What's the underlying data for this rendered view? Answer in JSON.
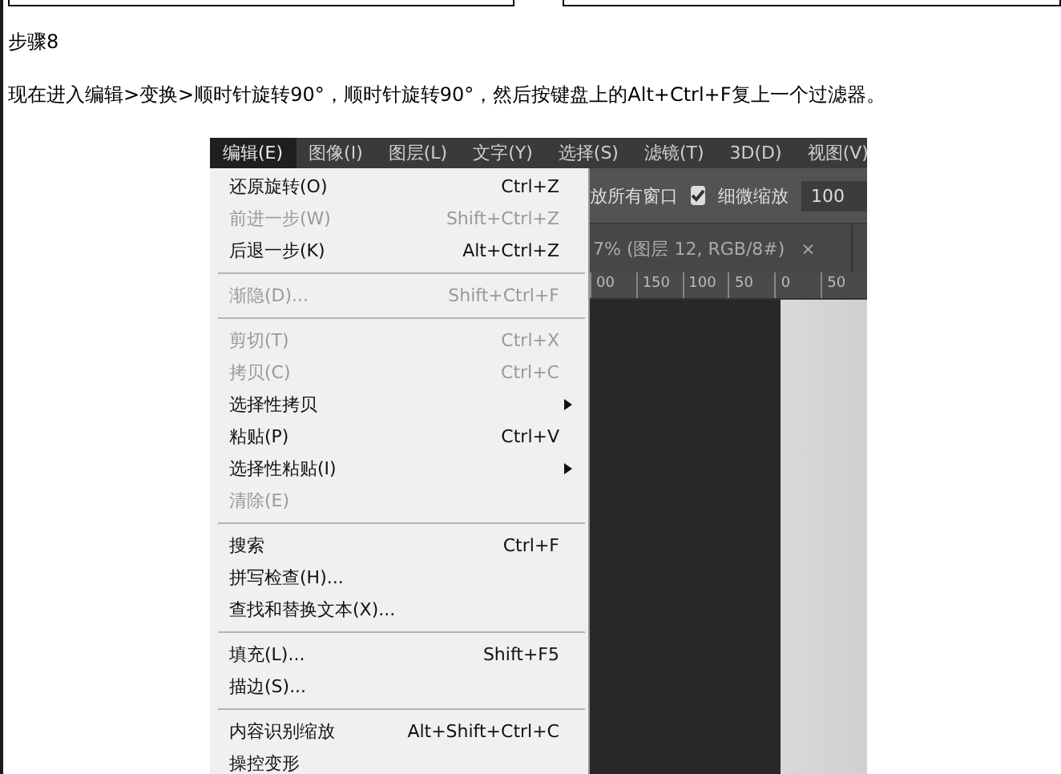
{
  "article": {
    "step_title": "步骤8",
    "paragraph": "现在进入编辑>变换>顺时针旋转90°，顺时针旋转90°，然后按键盘上的Alt+Ctrl+F复上一个过滤器。"
  },
  "screenshot": {
    "menubar": [
      {
        "label": "编辑(E)",
        "selected": true
      },
      {
        "label": "图像(I)",
        "selected": false
      },
      {
        "label": "图层(L)",
        "selected": false
      },
      {
        "label": "文字(Y)",
        "selected": false
      },
      {
        "label": "选择(S)",
        "selected": false
      },
      {
        "label": "滤镜(T)",
        "selected": false
      },
      {
        "label": "3D(D)",
        "selected": false
      },
      {
        "label": "视图(V)",
        "selected": false
      }
    ],
    "edit_menu": [
      {
        "kind": "item",
        "label": "还原旋转(O)",
        "shortcut": "Ctrl+Z",
        "disabled": false
      },
      {
        "kind": "item",
        "label": "前进一步(W)",
        "shortcut": "Shift+Ctrl+Z",
        "disabled": true
      },
      {
        "kind": "item",
        "label": "后退一步(K)",
        "shortcut": "Alt+Ctrl+Z",
        "disabled": false
      },
      {
        "kind": "separator"
      },
      {
        "kind": "item",
        "label": "渐隐(D)...",
        "shortcut": "Shift+Ctrl+F",
        "disabled": true
      },
      {
        "kind": "separator"
      },
      {
        "kind": "item",
        "label": "剪切(T)",
        "shortcut": "Ctrl+X",
        "disabled": true
      },
      {
        "kind": "item",
        "label": "拷贝(C)",
        "shortcut": "Ctrl+C",
        "disabled": true
      },
      {
        "kind": "submenu",
        "label": "选择性拷贝",
        "disabled": false
      },
      {
        "kind": "item",
        "label": "粘贴(P)",
        "shortcut": "Ctrl+V",
        "disabled": false
      },
      {
        "kind": "submenu",
        "label": "选择性粘贴(I)",
        "disabled": false
      },
      {
        "kind": "item",
        "label": "清除(E)",
        "disabled": true
      },
      {
        "kind": "separator"
      },
      {
        "kind": "item",
        "label": "搜索",
        "shortcut": "Ctrl+F",
        "disabled": false
      },
      {
        "kind": "item",
        "label": "拼写检查(H)...",
        "disabled": false
      },
      {
        "kind": "item",
        "label": "查找和替换文本(X)...",
        "disabled": false
      },
      {
        "kind": "separator"
      },
      {
        "kind": "item",
        "label": "填充(L)...",
        "shortcut": "Shift+F5",
        "disabled": false
      },
      {
        "kind": "item",
        "label": "描边(S)...",
        "disabled": false
      },
      {
        "kind": "separator"
      },
      {
        "kind": "item",
        "label": "内容识别缩放",
        "shortcut": "Alt+Shift+Ctrl+C",
        "disabled": false
      },
      {
        "kind": "item",
        "label": "操控变形",
        "disabled": false
      }
    ],
    "options_bar": {
      "label": "放所有窗口",
      "checkbox": {
        "label": "细微缩放",
        "checked": true
      },
      "field": {
        "value": "100"
      }
    },
    "document_tab": {
      "title": "7% (图层 12, RGB/8#)",
      "close": "×"
    },
    "ruler": [
      "00",
      "150",
      "100",
      "50",
      "0",
      "50"
    ]
  }
}
